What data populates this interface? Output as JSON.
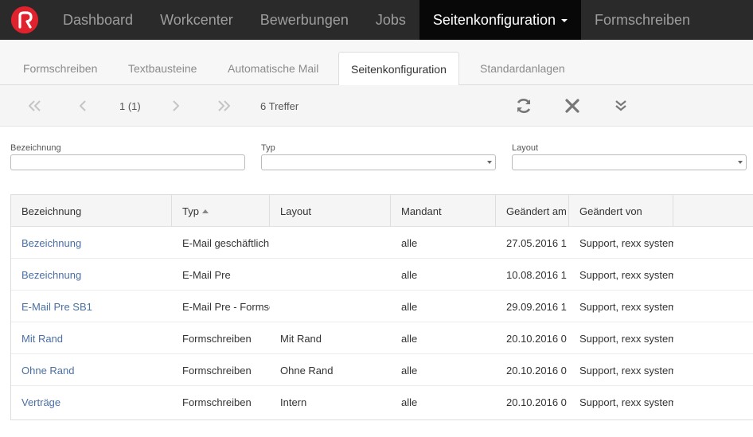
{
  "topnav": {
    "items": [
      {
        "label": "Dashboard"
      },
      {
        "label": "Workcenter"
      },
      {
        "label": "Bewerbungen"
      },
      {
        "label": "Jobs"
      },
      {
        "label": "Seitenkonfiguration"
      },
      {
        "label": "Formschreiben"
      }
    ]
  },
  "subtabs": [
    {
      "label": "Formschreiben"
    },
    {
      "label": "Textbausteine"
    },
    {
      "label": "Automatische Mail"
    },
    {
      "label": "Seitenkonfiguration"
    },
    {
      "label": "Standardanlagen"
    }
  ],
  "toolbar": {
    "page": "1 (1)",
    "hits": "6 Treffer"
  },
  "filters": {
    "bezeichnung_label": "Bezeichnung",
    "typ_label": "Typ",
    "layout_label": "Layout"
  },
  "grid": {
    "headers": [
      "Bezeichnung",
      "Typ",
      "Layout",
      "Mandant",
      "Geändert am",
      "Geändert von"
    ],
    "rows": [
      [
        "Bezeichnung",
        "E-Mail geschäftlich",
        "",
        "alle",
        "27.05.2016 1",
        "Support, rexx systems"
      ],
      [
        "Bezeichnung",
        "E-Mail Pre",
        "",
        "alle",
        "10.08.2016 1",
        "Support, rexx systems"
      ],
      [
        "E-Mail Pre SB1",
        "E-Mail Pre - Formschreiben",
        "",
        "alle",
        "29.09.2016 1",
        "Support, rexx systems"
      ],
      [
        "Mit Rand",
        "Formschreiben",
        "Mit Rand",
        "alle",
        "20.10.2016 0",
        "Support, rexx systems"
      ],
      [
        "Ohne Rand",
        "Formschreiben",
        "Ohne Rand",
        "alle",
        "20.10.2016 0",
        "Support, rexx systems"
      ],
      [
        "Verträge",
        "Formschreiben",
        "Intern",
        "alle",
        "20.10.2016 0",
        "Support, rexx systems"
      ]
    ]
  }
}
